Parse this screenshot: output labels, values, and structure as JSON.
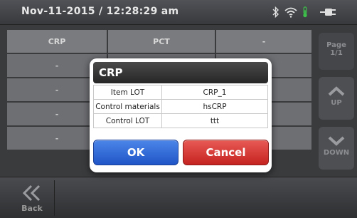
{
  "status_bar": {
    "datetime": "Nov-11-2015 / 12:28:29 am",
    "icons": [
      "bluetooth-icon",
      "wifi-icon",
      "thermometer-icon",
      "plug-icon"
    ]
  },
  "table": {
    "headers": [
      "CRP",
      "PCT",
      "-"
    ],
    "rows": [
      [
        "-",
        "",
        ""
      ],
      [
        "-",
        "",
        ""
      ],
      [
        "-",
        "",
        ""
      ],
      [
        "-",
        "",
        ""
      ]
    ]
  },
  "side": {
    "page_label": "Page",
    "page_value": "1/1",
    "up_label": "UP",
    "down_label": "DOWN"
  },
  "bottom": {
    "back_label": "Back"
  },
  "dialog": {
    "title": "CRP",
    "rows": [
      {
        "label": "Item LOT",
        "value": "CRP_1"
      },
      {
        "label": "Control materials",
        "value": "hsCRP"
      },
      {
        "label": "Control LOT",
        "value": "ttt"
      }
    ],
    "ok_label": "OK",
    "cancel_label": "Cancel"
  },
  "colors": {
    "ok": "#2a63d6",
    "cancel": "#d3302b",
    "title_bar": "#2e2e2e",
    "thermometer": "#3dbf4a"
  }
}
